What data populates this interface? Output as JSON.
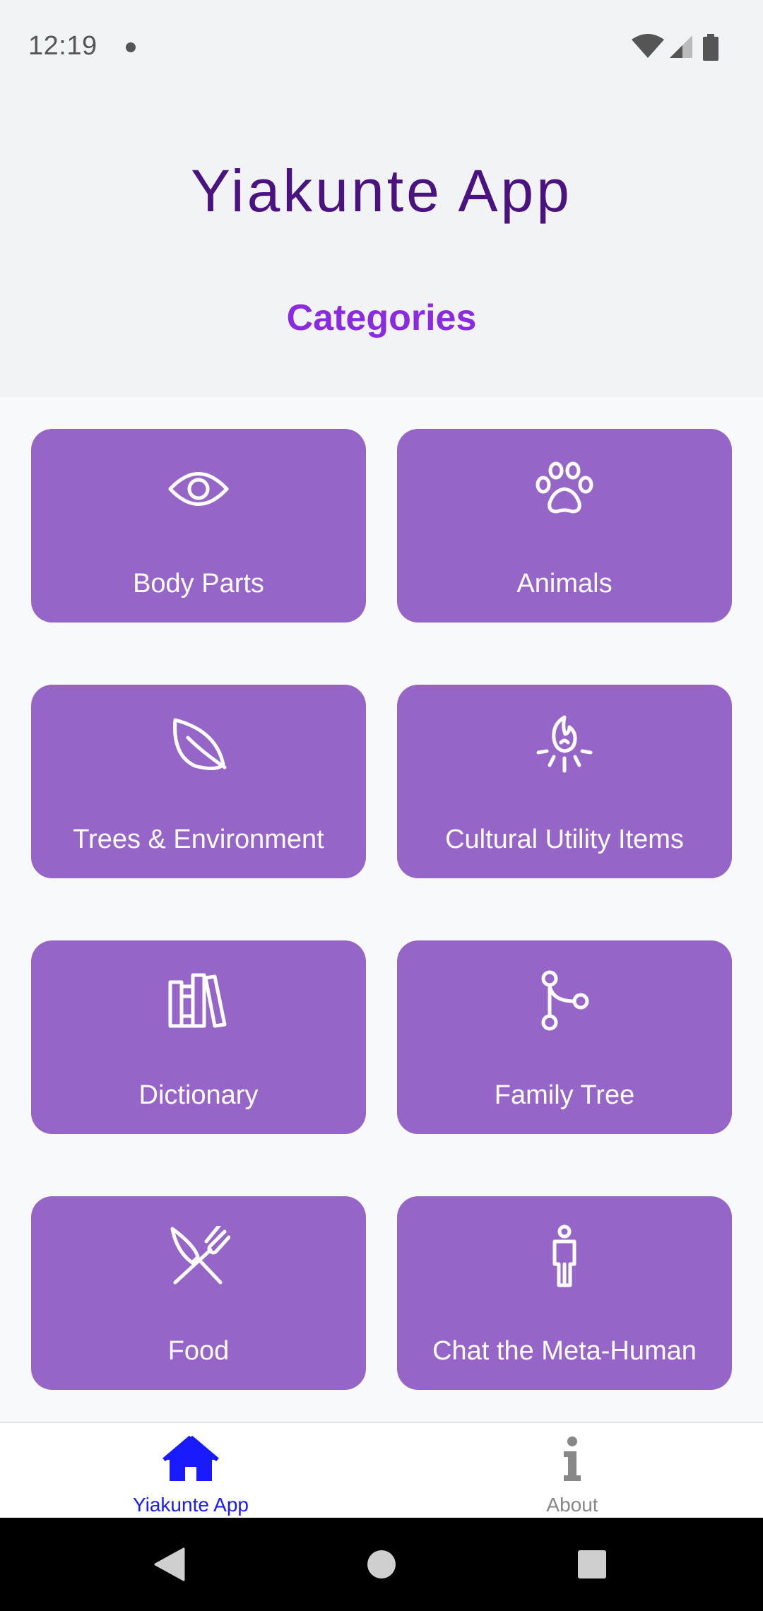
{
  "status_bar": {
    "time": "12:19"
  },
  "header": {
    "app_title": "Yiakunte App",
    "section_title": "Categories"
  },
  "categories": [
    {
      "label": "Body Parts",
      "icon": "eye-icon"
    },
    {
      "label": "Animals",
      "icon": "paw-icon"
    },
    {
      "label": "Trees & Environment",
      "icon": "leaf-icon"
    },
    {
      "label": "Cultural Utility Items",
      "icon": "campfire-icon"
    },
    {
      "label": "Dictionary",
      "icon": "books-icon"
    },
    {
      "label": "Family Tree",
      "icon": "branch-icon"
    },
    {
      "label": "Food",
      "icon": "utensils-icon"
    },
    {
      "label": "Chat the Meta-Human",
      "icon": "person-icon"
    }
  ],
  "bottom_nav": {
    "items": [
      {
        "label": "Yiakunte App",
        "icon": "home-icon",
        "active": true
      },
      {
        "label": "About",
        "icon": "info-icon",
        "active": false
      }
    ]
  },
  "colors": {
    "title": "#4a1380",
    "section_title": "#8a2be2",
    "card": "#9566c8",
    "nav_active": "#1a1aff",
    "nav_inactive": "#888888"
  }
}
